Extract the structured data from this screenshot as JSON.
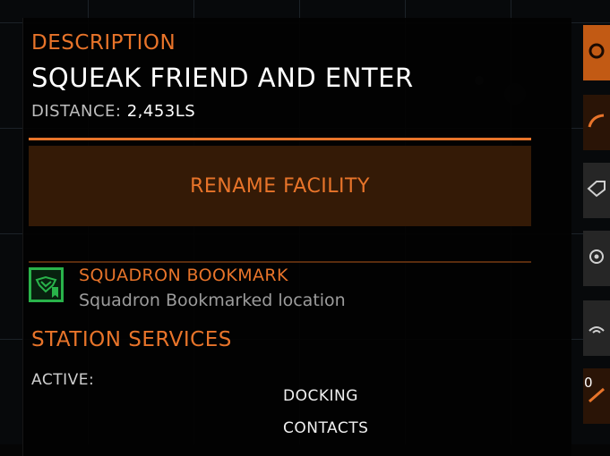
{
  "panel": {
    "description_label": "DESCRIPTION",
    "facility_name": "SQUEAK FRIEND AND ENTER",
    "distance_label": "DISTANCE:",
    "distance_value": "2,453LS",
    "rename_button_label": "RENAME FACILITY"
  },
  "bookmark": {
    "title": "SQUADRON BOOKMARK",
    "subtitle": "Squadron Bookmarked location",
    "icon": "squadron-bookmark-icon"
  },
  "services": {
    "heading": "STATION SERVICES",
    "active_label": "ACTIVE:",
    "items": [
      "DOCKING",
      "CONTACTS"
    ]
  },
  "side_panel": {
    "counter": "0",
    "tabs": [
      {
        "icon": "faction-icon"
      },
      {
        "icon": "arc-icon"
      },
      {
        "icon": "tag-icon"
      },
      {
        "icon": "eye-icon"
      },
      {
        "icon": "signal-icon"
      },
      {
        "icon": "triangle-icon"
      }
    ]
  },
  "colors": {
    "accent": "#e8742a",
    "button_bg": "#341a06",
    "bookmark_green": "#29b34a",
    "text_white": "#ffffff",
    "text_grey": "#9c9c9c"
  }
}
